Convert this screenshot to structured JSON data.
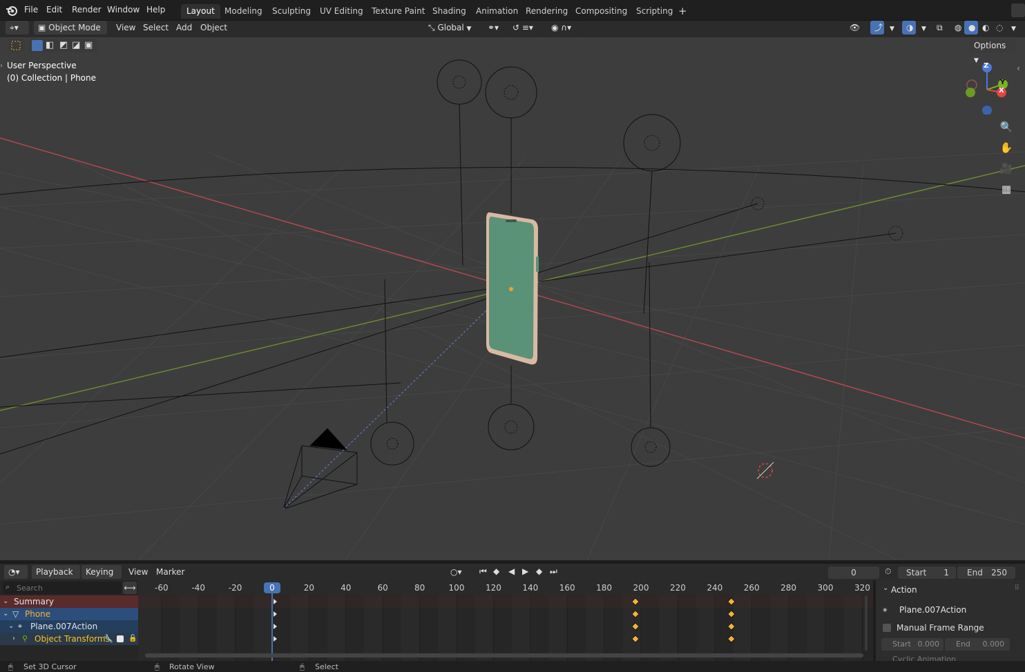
{
  "topbar": {
    "menus": [
      "File",
      "Edit",
      "Render",
      "Window",
      "Help"
    ],
    "workspaces": [
      "Layout",
      "Modeling",
      "Sculpting",
      "UV Editing",
      "Texture Paint",
      "Shading",
      "Animation",
      "Rendering",
      "Compositing",
      "Scripting"
    ],
    "active_workspace": "Layout",
    "add_tab": "+"
  },
  "viewport_header": {
    "mode": "Object Mode",
    "menus": [
      "View",
      "Select",
      "Add",
      "Object"
    ],
    "orientation": "Global",
    "options": "Options"
  },
  "viewport": {
    "perspective_label": "User Perspective",
    "collection_label": "(0) Collection | Phone",
    "gizmo": {
      "z": "Z",
      "y": "Y",
      "x": "X"
    },
    "colors": {
      "background": "#3d3d3d",
      "x_axis": "#b5484f",
      "y_axis": "#6d8a2f",
      "phone_screen": "#5a9277",
      "phone_frame": "#d9b9a4"
    }
  },
  "timeline": {
    "menus": [
      "Playback",
      "Keying",
      "View",
      "Marker"
    ],
    "current_frame": "0",
    "start_label": "Start",
    "start_value": "1",
    "end_label": "End",
    "end_value": "250",
    "ruler_ticks": [
      "-60",
      "-40",
      "-20",
      "0",
      "20",
      "40",
      "60",
      "80",
      "100",
      "120",
      "140",
      "160",
      "180",
      "200",
      "220",
      "240",
      "260",
      "280",
      "300",
      "320"
    ],
    "search_placeholder": "Search",
    "channels": [
      {
        "label": "Summary"
      },
      {
        "label": "Phone"
      },
      {
        "label": "Plane.007Action"
      },
      {
        "label": "Object Transforms"
      }
    ],
    "keyframes": [
      0,
      197,
      249
    ],
    "colors": {
      "playhead": "#4772b3",
      "keyframe": "#f0b33a"
    }
  },
  "action_panel": {
    "title": "Action",
    "action_name": "Plane.007Action",
    "manual_range_label": "Manual Frame Range",
    "start_label": "Start",
    "start_value": "0.000",
    "end_label": "End",
    "end_value": "0.000",
    "cyclic_label": "Cyclic Animation"
  },
  "statusbar": {
    "items": [
      "Set 3D Cursor",
      "Rotate View",
      "Select"
    ]
  }
}
